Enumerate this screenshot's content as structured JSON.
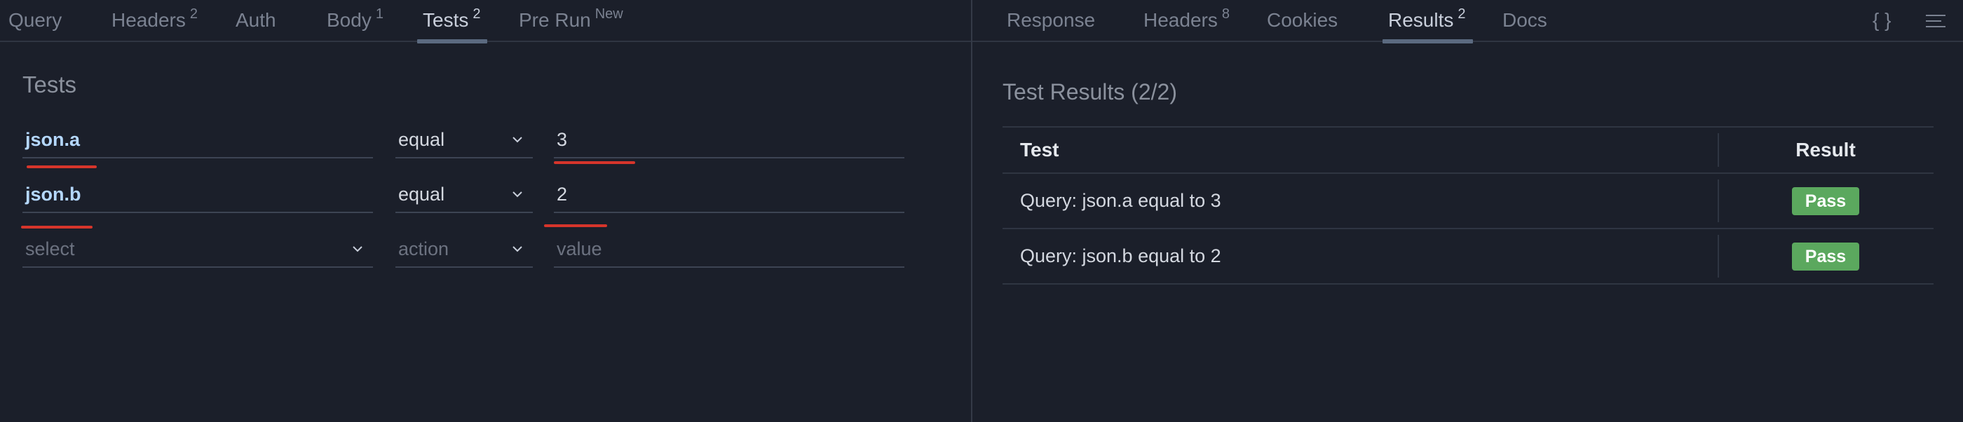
{
  "request_tabs": [
    {
      "label": "Query",
      "badge": ""
    },
    {
      "label": "Headers",
      "badge": "2"
    },
    {
      "label": "Auth",
      "badge": ""
    },
    {
      "label": "Body",
      "badge": "1"
    },
    {
      "label": "Tests",
      "badge": "2"
    },
    {
      "label": "Pre Run",
      "badge": "New"
    }
  ],
  "request_active_tab": "Tests",
  "tests": {
    "title": "Tests",
    "rows": [
      {
        "key": "json.a",
        "action": "equal",
        "value": "3"
      },
      {
        "key": "json.b",
        "action": "equal",
        "value": "2"
      }
    ],
    "new_row": {
      "key_placeholder": "select",
      "action_placeholder": "action",
      "value_placeholder": "value"
    }
  },
  "response_tabs": [
    {
      "label": "Response",
      "badge": ""
    },
    {
      "label": "Headers",
      "badge": "8"
    },
    {
      "label": "Cookies",
      "badge": ""
    },
    {
      "label": "Results",
      "badge": "2"
    },
    {
      "label": "Docs",
      "badge": ""
    }
  ],
  "response_active_tab": "Results",
  "toolbar": {
    "json_icon": "{ }",
    "menu_icon": "menu-icon"
  },
  "results": {
    "title": "Test Results (2/2)",
    "headers": {
      "test": "Test",
      "result": "Result"
    },
    "rows": [
      {
        "test": "Query: json.a equal to 3",
        "result": "Pass"
      },
      {
        "test": "Query: json.b equal to 2",
        "result": "Pass"
      }
    ]
  },
  "colors": {
    "background": "#1b1f2a",
    "pass": "#5ba85e",
    "error_underline": "#d6352b",
    "active_tab": "#5b6a80"
  }
}
